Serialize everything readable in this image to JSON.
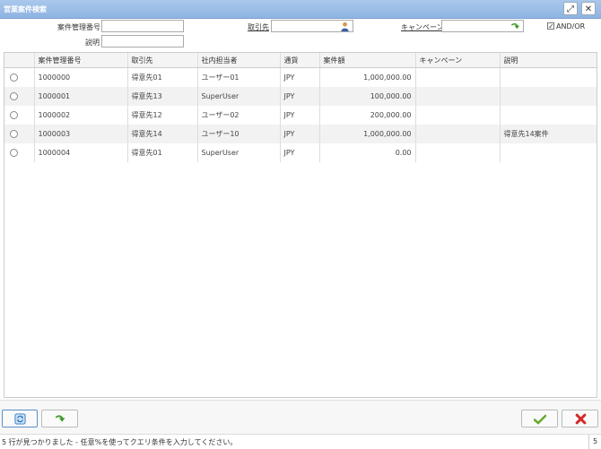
{
  "window": {
    "title": "営業案件検索"
  },
  "filters": {
    "deal_no_label": "案件管理番号",
    "description_label": "説明",
    "customer_label": "取引先",
    "campaign_label": "キャンペーン",
    "and_or_label": "AND/OR",
    "deal_no_value": "",
    "description_value": "",
    "customer_value": "",
    "campaign_value": "",
    "and_or_checked": true
  },
  "table": {
    "columns": [
      "案件管理番号",
      "取引先",
      "社内担当者",
      "通貨",
      "案件額",
      "キャンペーン",
      "説明"
    ],
    "rows": [
      [
        "1000000",
        "得意先01",
        "ユーザー01",
        "JPY",
        "1,000,000.00",
        "",
        ""
      ],
      [
        "1000001",
        "得意先13",
        "SuperUser",
        "JPY",
        "100,000.00",
        "",
        ""
      ],
      [
        "1000002",
        "得意先12",
        "ユーザー02",
        "JPY",
        "200,000.00",
        "",
        ""
      ],
      [
        "1000003",
        "得意先14",
        "ユーザー10",
        "JPY",
        "1,000,000.00",
        "",
        "得意先14案件"
      ],
      [
        "1000004",
        "得意先01",
        "SuperUser",
        "JPY",
        "0.00",
        "",
        ""
      ]
    ]
  },
  "status": {
    "message": "5 行が見つかりました - 任意%を使ってクエリ条件を入力してください。",
    "count": "5"
  },
  "colors": {
    "titlebar": "#96badf",
    "ok": "#6aa832",
    "cancel": "#d42a2a",
    "refresh": "#2a7ac8"
  }
}
